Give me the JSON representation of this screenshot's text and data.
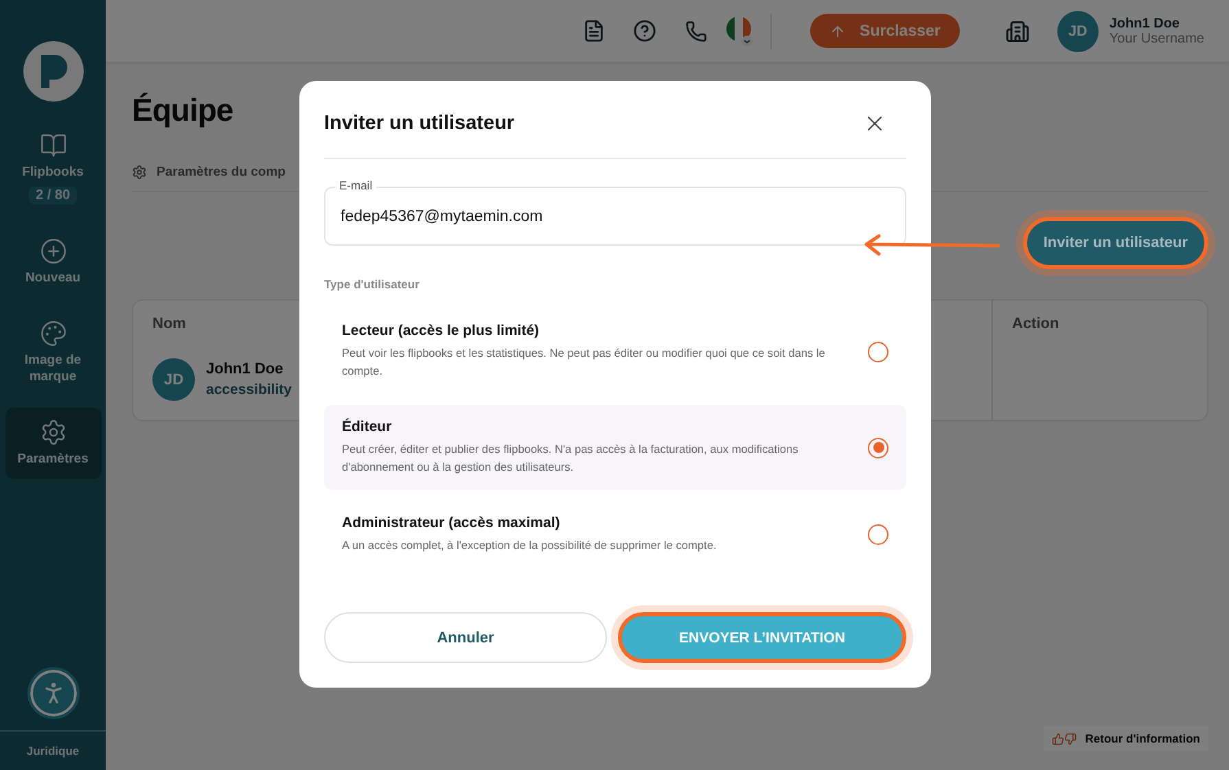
{
  "sidebar": {
    "items": [
      {
        "label": "Flipbooks",
        "badge": "2 / 80",
        "selected": false
      },
      {
        "label": "Nouveau",
        "selected": false
      },
      {
        "label": "Image de marque",
        "selected": false
      },
      {
        "label": "Paramètres",
        "selected": true
      }
    ],
    "footer_link": "Juridique"
  },
  "header": {
    "upgrade_button": "Surclasser",
    "user": {
      "initials": "JD",
      "name": "John1 Doe",
      "username": "Your Username"
    }
  },
  "page": {
    "title": "Équipe",
    "tab": "Paramètres du comp",
    "invite_button": "Inviter un utilisateur",
    "table": {
      "columns": [
        "Nom",
        "Action"
      ],
      "rows": [
        {
          "initials": "JD",
          "name": "John1 Doe",
          "detail": "accessibility"
        }
      ]
    },
    "feedback_button": "Retour d'information"
  },
  "dialog": {
    "title": "Inviter un utilisateur",
    "email": {
      "label": "E-mail",
      "value": "fedep45367@mytaemin.com"
    },
    "section_label": "Type d'utilisateur",
    "options": [
      {
        "title": "Lecteur (accès le plus limité)",
        "description": "Peut voir les flipbooks et les statistiques. Ne peut pas éditer ou modifier quoi que ce soit dans le compte.",
        "selected": false
      },
      {
        "title": "Éditeur",
        "description": "Peut créer, éditer et publier des flipbooks. N'a pas accès à la facturation, aux modifications d'abonnement ou à la gestion des utilisateurs.",
        "selected": true
      },
      {
        "title": "Administrateur (accès maximal)",
        "description": "A un accès complet, à l'exception de la possibilité de supprimer le compte.",
        "selected": false
      }
    ],
    "cancel_button": "Annuler",
    "submit_button": "ENVOYER L’INVITATION"
  }
}
